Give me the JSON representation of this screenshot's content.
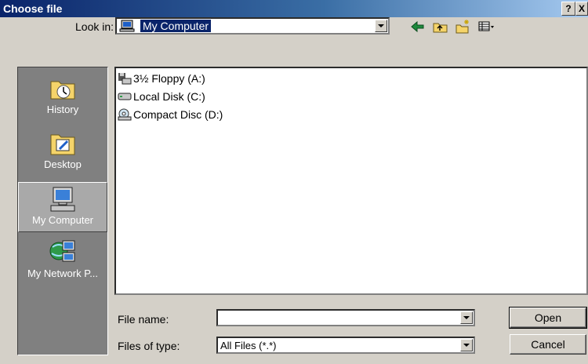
{
  "window": {
    "title": "Choose file",
    "help_label": "?",
    "close_label": "X"
  },
  "toolbar": {
    "look_in_label": "Look in:",
    "look_in_value": "My Computer",
    "tools": [
      "back-icon",
      "up-folder-icon",
      "new-folder-icon",
      "view-menu-icon"
    ]
  },
  "places": [
    {
      "label": "History",
      "icon": "history-icon",
      "selected": false
    },
    {
      "label": "Desktop",
      "icon": "desktop-icon",
      "selected": false
    },
    {
      "label": "My Computer",
      "icon": "my-computer-icon",
      "selected": true
    },
    {
      "label": "My Network P...",
      "icon": "network-icon",
      "selected": false
    }
  ],
  "files": [
    {
      "name": "3½ Floppy (A:)",
      "icon": "floppy-drive-icon"
    },
    {
      "name": "Local Disk (C:)",
      "icon": "hard-disk-icon"
    },
    {
      "name": "Compact Disc (D:)",
      "icon": "cd-drive-icon"
    }
  ],
  "form": {
    "file_name_label": "File name:",
    "file_name_value": "",
    "file_type_label": "Files of type:",
    "file_type_value": "All Files (*.*)"
  },
  "buttons": {
    "open_label": "Open",
    "cancel_label": "Cancel"
  }
}
